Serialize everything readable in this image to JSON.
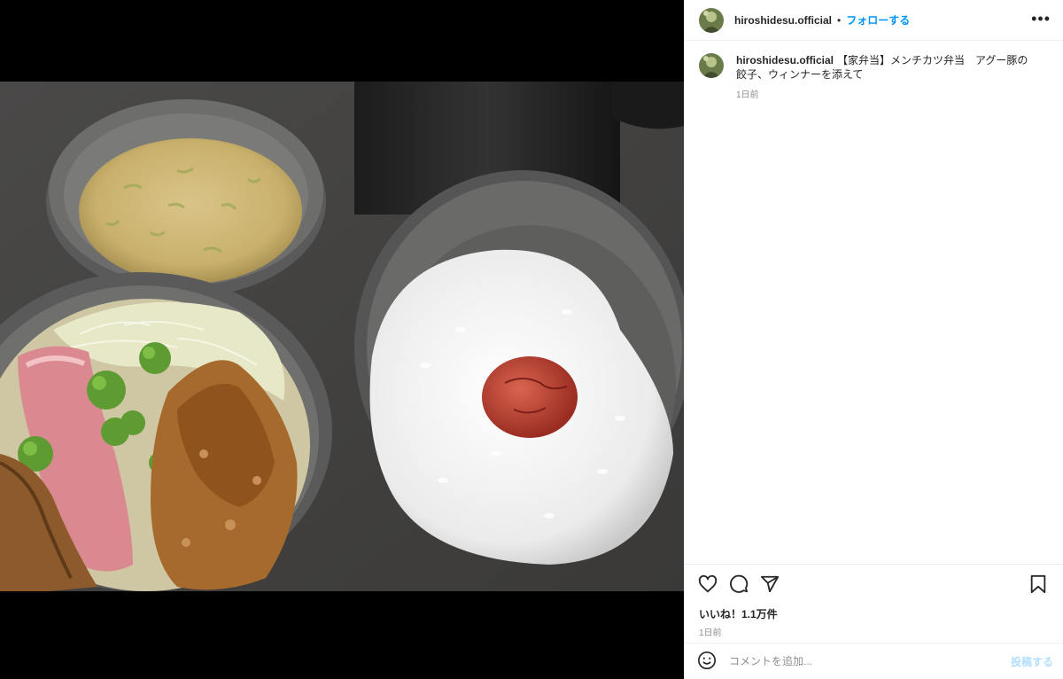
{
  "post": {
    "username": "hiroshidesu.official",
    "separator": "•",
    "follow_label": "フォローする",
    "more_label": "•••"
  },
  "caption": {
    "username": "hiroshidesu.official",
    "text": "【家弁当】メンチカツ弁当　アグー豚の餃子、ウィンナーを添えて",
    "time": "1日前"
  },
  "actions": {
    "like_icon": "heart-icon",
    "comment_icon": "comment-icon",
    "share_icon": "share-icon",
    "save_icon": "bookmark-icon"
  },
  "engagement": {
    "likes": "いいね！1.1万件",
    "time": "1日前"
  },
  "comment": {
    "placeholder": "コメントを追加...",
    "post_label": "投稿する",
    "emoji_icon": "emoji-icon"
  },
  "colors": {
    "accent": "#0095f6",
    "post_disabled": "#b2dffc",
    "muted": "#8e8e8e"
  }
}
